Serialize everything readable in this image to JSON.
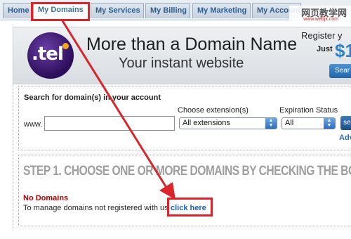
{
  "nav": {
    "tabs": [
      {
        "label": "Home",
        "active": false
      },
      {
        "label": "My Domains",
        "active": true
      },
      {
        "label": "My Services",
        "active": false
      },
      {
        "label": "My Billing",
        "active": false
      },
      {
        "label": "My Marketing",
        "active": false
      },
      {
        "label": "My Account",
        "active": false
      }
    ],
    "watermark_main": "网页教学网",
    "watermark_sub": "www.webjx.com"
  },
  "banner": {
    "logo_text": ".tel",
    "headline": "More than a Domain Name",
    "subline": "Your instant website",
    "register_text": "Register y",
    "just_text": "Just",
    "price_text": "$1",
    "search_button": "Sear"
  },
  "search": {
    "title": "Search for domain(s) in your account",
    "www_label": "www.",
    "domain_value": "",
    "extension_label": "Choose extension(s)",
    "extension_value": "All extensions",
    "expiration_label": "Expiration Status",
    "expiration_value": "All",
    "go_button": "se",
    "advanced_link": "Adv"
  },
  "step": {
    "title": "STEP 1. CHOOSE ONE OR MORE DOMAINS BY CHECKING THE BO",
    "no_domains": "No Domains",
    "manage_text": "To manage domains not registered with us",
    "click_here": "click here"
  },
  "colors": {
    "accent_tab": "#2b5f93",
    "highlight": "#d8262c",
    "error": "#b40000",
    "link": "#1a5fb4"
  }
}
